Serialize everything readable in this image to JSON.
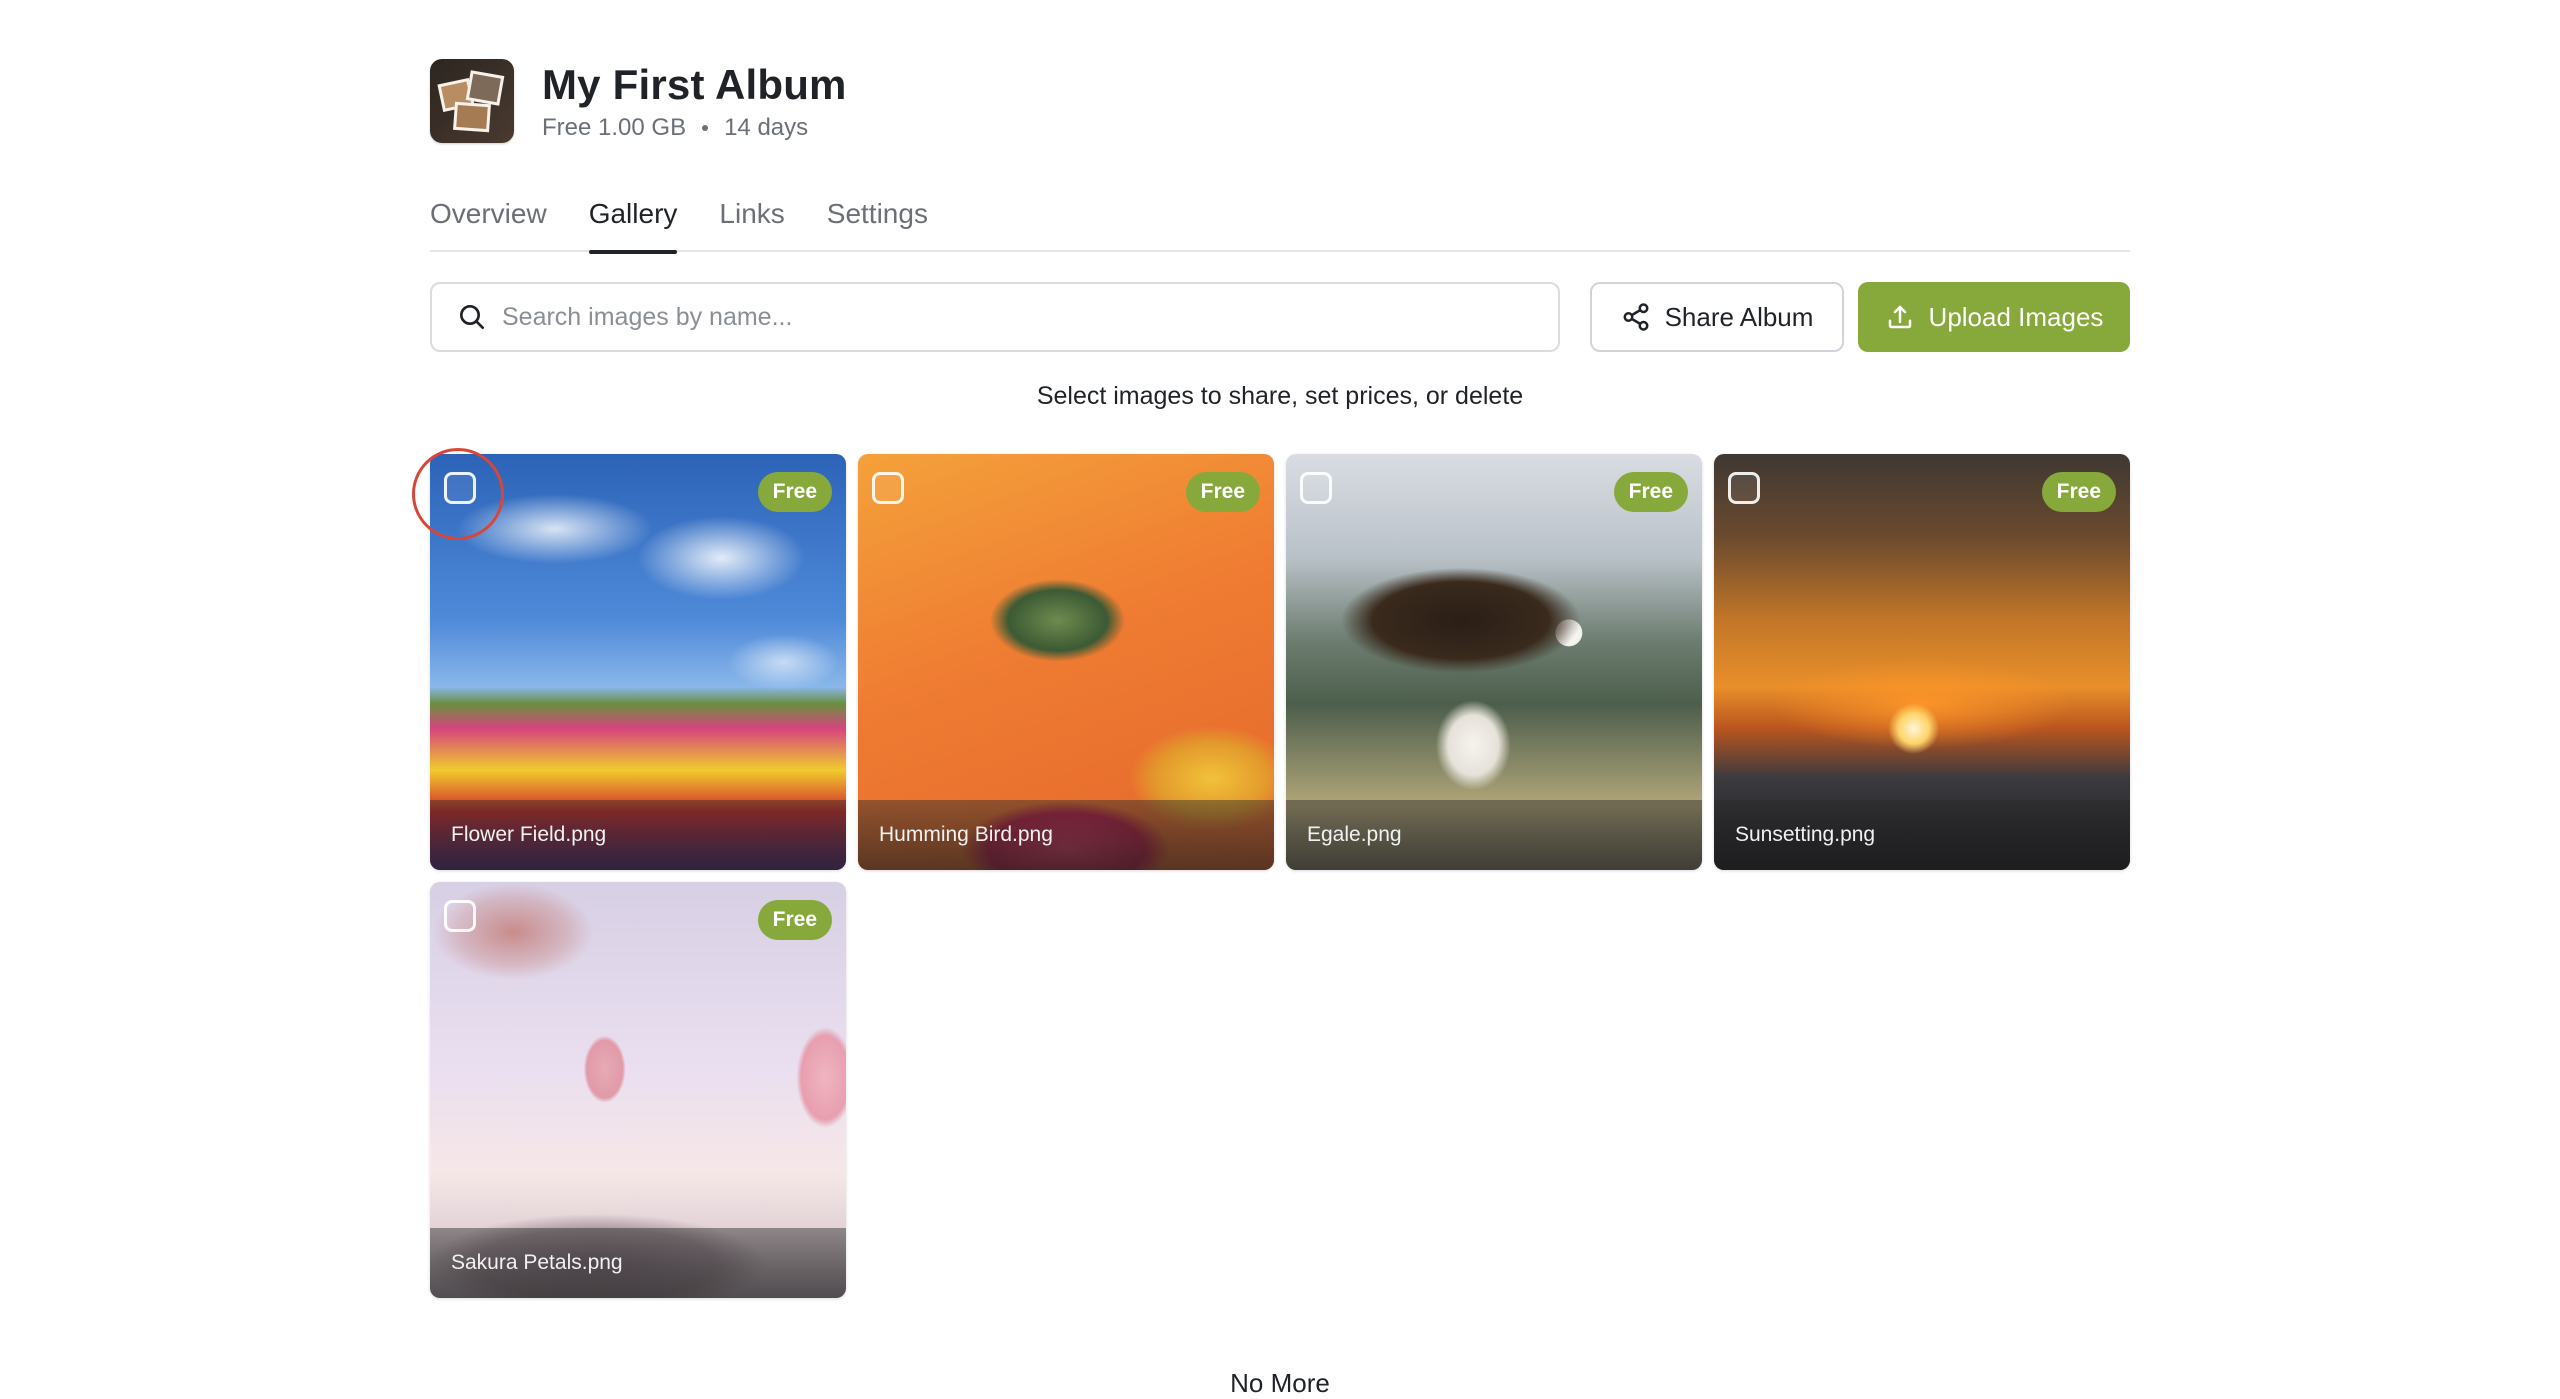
{
  "album": {
    "title": "My First Album",
    "plan": "Free 1.00 GB",
    "duration": "14 days",
    "thumbnail_icon": "photo-stack-thumbnail"
  },
  "tabs": [
    {
      "label": "Overview",
      "active": false
    },
    {
      "label": "Gallery",
      "active": true
    },
    {
      "label": "Links",
      "active": false
    },
    {
      "label": "Settings",
      "active": false
    }
  ],
  "toolbar": {
    "search_placeholder": "Search images by name...",
    "search_icon": "search-icon",
    "share_label": "Share Album",
    "share_icon": "share-icon",
    "upload_label": "Upload Images",
    "upload_icon": "upload-icon"
  },
  "helper_text": "Select images to share, set prices, or delete",
  "gallery": {
    "items": [
      {
        "name": "Flower Field.png",
        "badge": "Free",
        "selected": false
      },
      {
        "name": "Humming Bird.png",
        "badge": "Free",
        "selected": false
      },
      {
        "name": "Egale.png",
        "badge": "Free",
        "selected": false
      },
      {
        "name": "Sunsetting.png",
        "badge": "Free",
        "selected": false
      },
      {
        "name": "Sakura Petals.png",
        "badge": "Free",
        "selected": false
      }
    ]
  },
  "footer_text": "No More",
  "colors": {
    "accent": "#87a83a",
    "highlight": "#d8463a",
    "text_primary": "#1f2328",
    "text_secondary": "#6b7078"
  }
}
